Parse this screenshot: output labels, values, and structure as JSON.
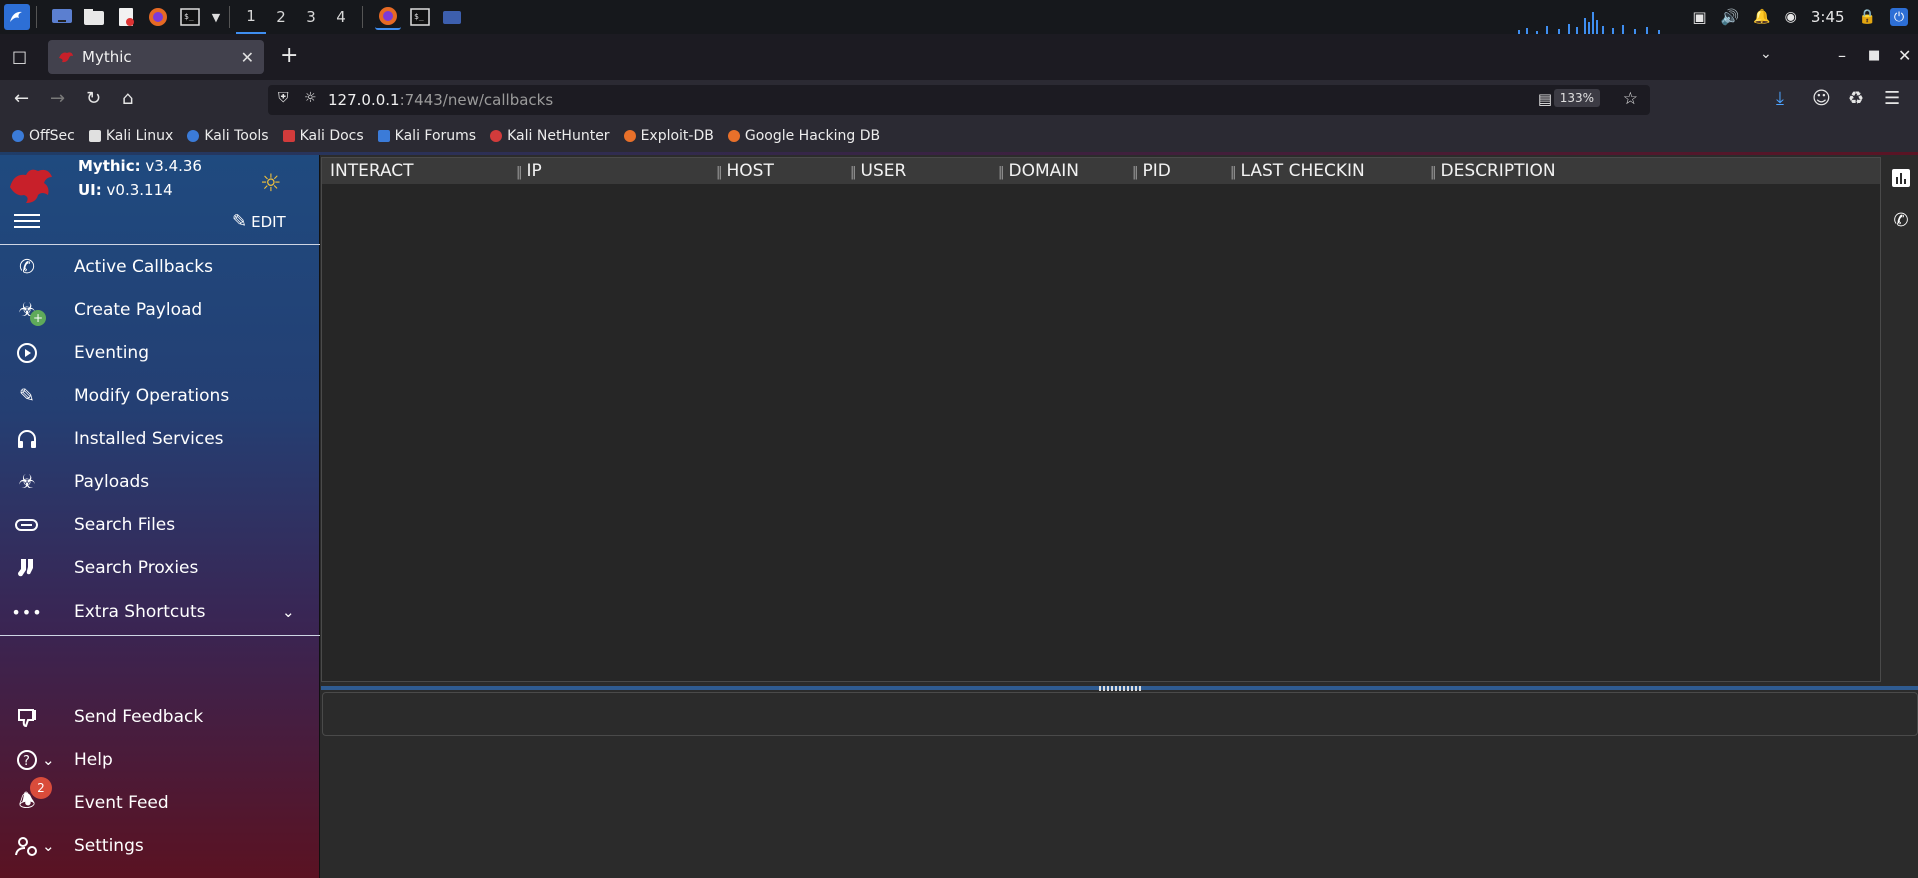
{
  "taskbar": {
    "workspaces": [
      "1",
      "2",
      "3",
      "4"
    ],
    "active_workspace": "1",
    "clock": "3:45",
    "icons": [
      "kali-menu-icon",
      "desktop-icon",
      "files-icon",
      "text-editor-icon",
      "firefox-icon",
      "terminal-icon",
      "chevron-down-icon",
      "firefox-window-icon",
      "terminal-window-icon",
      "files-window-icon"
    ],
    "tray_icons": [
      "display-icon",
      "volume-icon",
      "bell-icon",
      "updates-icon",
      "lock-icon",
      "power-icon"
    ]
  },
  "browser": {
    "tab_title": "Mythic",
    "url_host": "127.0.0.1",
    "url_rest": ":7443/new/callbacks",
    "zoom": "133%",
    "bookmarks": [
      "OffSec",
      "Kali Linux",
      "Kali Tools",
      "Kali Docs",
      "Kali Forums",
      "Kali NetHunter",
      "Exploit-DB",
      "Google Hacking DB"
    ],
    "bookmark_colors": [
      "#3b7bd8",
      "#e0e0e0",
      "#3b7bd8",
      "#d23b3b",
      "#3b7bd8",
      "#d23b3b",
      "#e8702a",
      "#e8702a"
    ]
  },
  "app": {
    "mythic_label": "Mythic:",
    "mythic_version": "v3.4.36",
    "ui_label": "UI:",
    "ui_version": "v0.3.114",
    "edit_label": "EDIT",
    "nav": [
      {
        "label": "Active Callbacks",
        "icon": "phone-callback-icon"
      },
      {
        "label": "Create Payload",
        "icon": "biohazard-add-icon"
      },
      {
        "label": "Eventing",
        "icon": "play-circle-icon"
      },
      {
        "label": "Modify Operations",
        "icon": "pencil-icon"
      },
      {
        "label": "Installed Services",
        "icon": "headphones-icon"
      },
      {
        "label": "Payloads",
        "icon": "biohazard-icon"
      },
      {
        "label": "Search Files",
        "icon": "paperclip-icon"
      },
      {
        "label": "Search Proxies",
        "icon": "socks-icon"
      },
      {
        "label": "Extra Shortcuts",
        "icon": "more-horiz-icon"
      }
    ],
    "bottom_nav": [
      {
        "label": "Send Feedback",
        "icon": "thumb-down-icon"
      },
      {
        "label": "Help",
        "icon": "help-circle-icon"
      },
      {
        "label": "Event Feed",
        "icon": "notification-bell-icon"
      },
      {
        "label": "Settings",
        "icon": "user-settings-icon"
      }
    ],
    "event_feed_count": "2",
    "accent_color": "#2f5b91",
    "theme_icon_color": "#f3c23b",
    "badge_color": "#d94c3b"
  },
  "table": {
    "columns": [
      "INTERACT",
      "IP",
      "HOST",
      "USER",
      "DOMAIN",
      "PID",
      "LAST CHECKIN",
      "DESCRIPTION"
    ],
    "rows": []
  }
}
